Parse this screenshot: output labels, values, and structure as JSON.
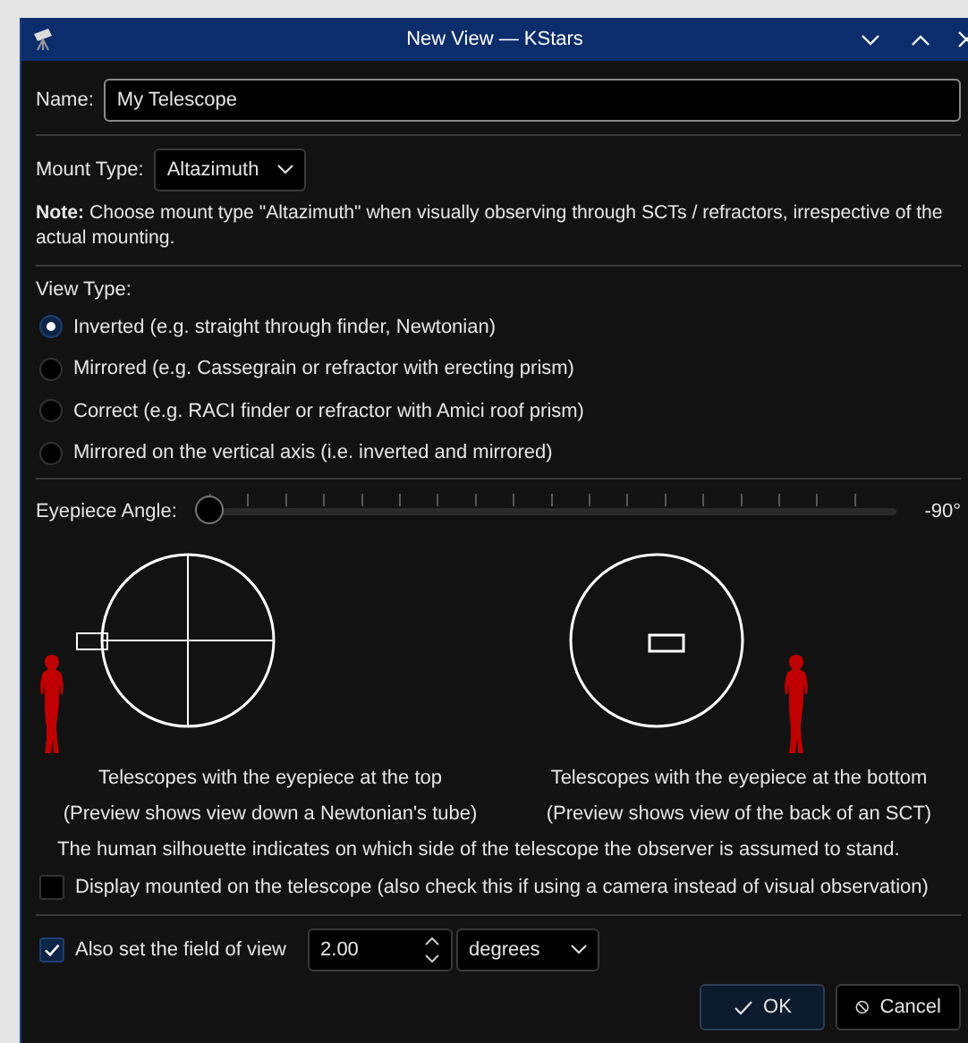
{
  "window": {
    "title": "New View — KStars"
  },
  "name": {
    "label": "Name:",
    "value": "My Telescope"
  },
  "mount_type": {
    "label": "Mount Type:",
    "value": "Altazimuth"
  },
  "note": "**Note:** Choose mount type \"Altazimuth\" when visually observing through SCTs / refractors, irrespective of the actual mounting.",
  "view_type": {
    "label": "View Type:",
    "options": [
      {
        "label": "Inverted (e.g. straight through finder, Newtonian)",
        "selected": true
      },
      {
        "label": "Mirrored (e.g. Cassegrain or refractor with erecting prism)",
        "selected": false
      },
      {
        "label": "Correct (e.g. RACI finder or refractor with Amici roof prism)",
        "selected": false
      },
      {
        "label": "Mirrored on the vertical axis (i.e. inverted and mirrored)",
        "selected": false
      }
    ]
  },
  "eyepiece_angle": {
    "label": "Eyepiece Angle:",
    "level": 0,
    "reading": "-90°"
  },
  "previews": [
    {
      "kind": "top",
      "caption": "Telescopes with the eyepiece at the top",
      "subcaption": "(Preview shows view down a Newtonian's tube)"
    },
    {
      "kind": "bottom",
      "caption": "Telescopes with the eyepiece at the bottom",
      "subcaption": "(Preview shows view of the back of an SCT)"
    }
  ],
  "silhouette_note": "The human silhouette indicates on which side of the telescope the observer is assumed to stand.",
  "display_mounted": {
    "label": "Display mounted on the telescope (also check this if using a camera instead of visual observation)",
    "checked": false
  },
  "field_of_view": {
    "label": "Also set the field of view",
    "checked": true,
    "value": "2.00",
    "unit": "degrees"
  },
  "buttons": [
    {
      "kind": "ok",
      "label": "OK"
    },
    {
      "kind": "cancel",
      "label": "Cancel"
    }
  ]
}
